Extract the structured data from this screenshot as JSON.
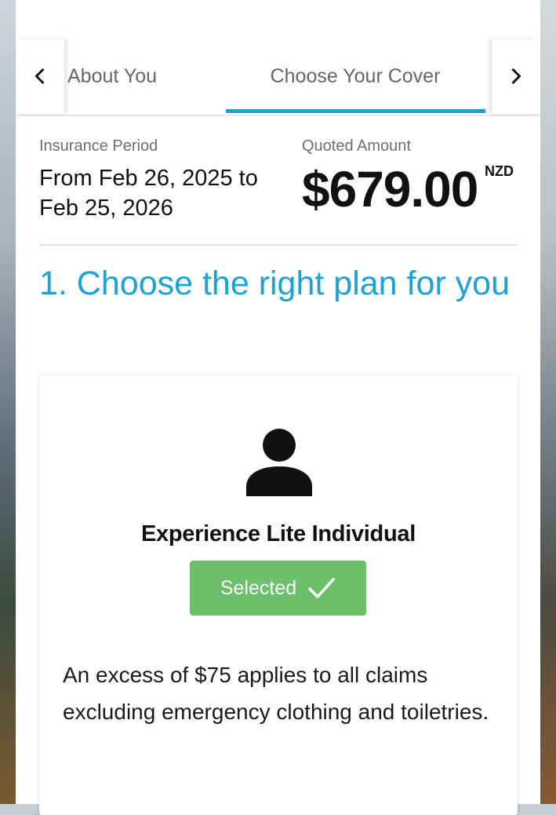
{
  "tabs": {
    "prev_icon": "chevron-left-icon",
    "next_icon": "chevron-right-icon",
    "items": [
      {
        "label": "About You",
        "active": false
      },
      {
        "label": "Choose Your Cover",
        "active": true
      }
    ],
    "accent_color": "#1aa3d4"
  },
  "summary": {
    "period_label": "Insurance Period",
    "period_value": "From Feb 26, 2025 to Feb 25, 2026",
    "amount_label": "Quoted Amount",
    "amount": "$679.00",
    "currency": "NZD"
  },
  "section": {
    "title": "1. Choose the right plan for you"
  },
  "plan": {
    "icon": "person-icon",
    "name": "Experience Lite Individual",
    "selected_label": "Selected",
    "selected_icon": "checkmark-icon",
    "selected_color": "#6cc06c",
    "description": "An excess of $75 applies to all claims excluding emergency clothing and toiletries."
  }
}
